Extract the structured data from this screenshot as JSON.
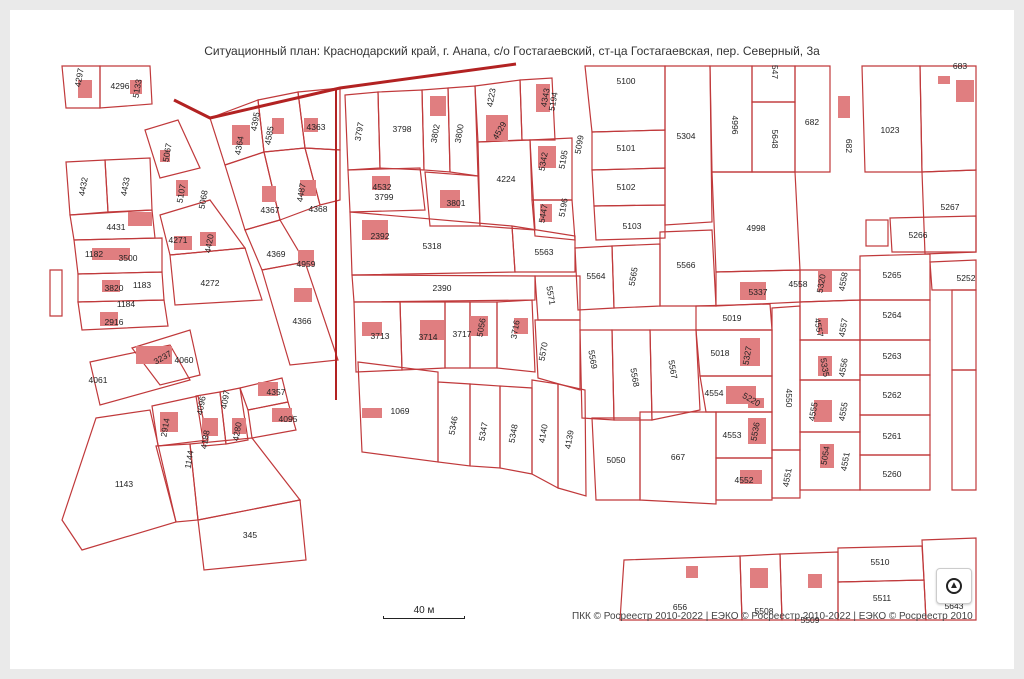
{
  "map": {
    "title": "Ситуационный план: Краснодарский край, г. Анапа, с/о Гостагаевский, ст-ца Гостагаевская, пер. Северный, 3а",
    "scale_label": "40 м",
    "attribution": "ПКК © Росреестр 2010-2022 | ЕЭКО © Росреестр 2010-2022 | ЕЭКО © Росреестр 2010",
    "compass_icon": "compass-icon",
    "colors": {
      "boundary": "#c0393b",
      "building": "#e07e80",
      "highlight": "#b22222",
      "background": "#ffffff"
    },
    "parcels": [
      "4297",
      "4296",
      "5133",
      "4395",
      "4585",
      "4363",
      "4364",
      "5067",
      "5107",
      "5068",
      "4367",
      "4487",
      "4368",
      "4432",
      "4433",
      "4431",
      "1182",
      "3500",
      "4271",
      "4420",
      "4369",
      "4959",
      "4272",
      "3820",
      "1183",
      "1184",
      "2916",
      "4366",
      "4061",
      "3237",
      "4060",
      "3797",
      "3798",
      "3802",
      "3800",
      "4223",
      "4529",
      "5194",
      "4532",
      "3799",
      "3801",
      "4224",
      "5342",
      "5195",
      "5447",
      "5196",
      "5099",
      "5100",
      "5101",
      "5102",
      "5103",
      "5304",
      "4996",
      "5648",
      "682",
      "1023",
      "2392",
      "5318",
      "5563",
      "5564",
      "5565",
      "5566",
      "4998",
      "5267",
      "5266",
      "2390",
      "5571",
      "5337",
      "4558",
      "5320",
      "5265",
      "5252",
      "3713",
      "3714",
      "3717",
      "5056",
      "3716",
      "5570",
      "5569",
      "5568",
      "5567",
      "5019",
      "5018",
      "5327",
      "4557",
      "5264",
      "5263",
      "4554",
      "5220",
      "4550",
      "5335",
      "4556",
      "5262",
      "1069",
      "5346",
      "5347",
      "5348",
      "4140",
      "4139",
      "5050",
      "667",
      "4553",
      "5536",
      "4555",
      "5261",
      "4096",
      "4097",
      "4280",
      "4357",
      "4095",
      "2914",
      "4188",
      "1144",
      "1143",
      "4552",
      "4551",
      "5054",
      "5260",
      "345",
      "656",
      "5508",
      "5509",
      "5510",
      "5511",
      "5643",
      "547"
    ]
  }
}
